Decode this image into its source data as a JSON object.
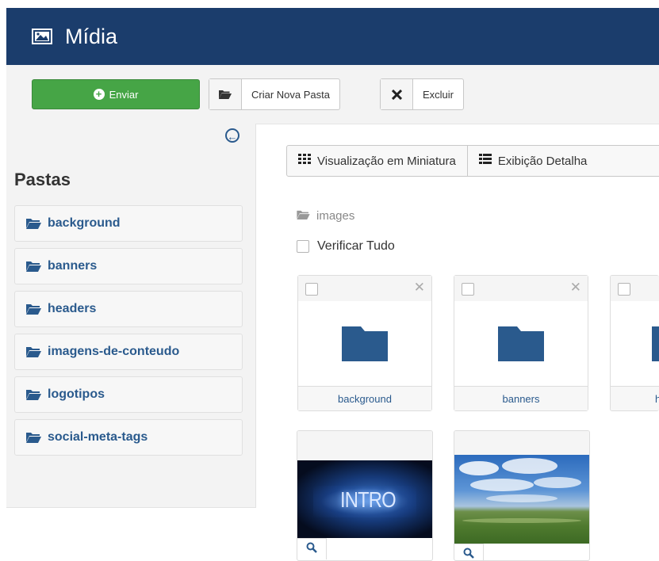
{
  "header": {
    "title": "Mídia",
    "icon": "image-icon",
    "bg_color": "#1b3d6c"
  },
  "toolbar": {
    "upload_label": "Enviar",
    "upload_color": "#46a546",
    "new_folder_label": "Criar Nova Pasta",
    "delete_label": "Excluir"
  },
  "sidebar": {
    "heading": "Pastas",
    "folders": [
      {
        "label": "background"
      },
      {
        "label": "banners"
      },
      {
        "label": "headers"
      },
      {
        "label": "imagens-de-conteudo"
      },
      {
        "label": "logotipos"
      },
      {
        "label": "social-meta-tags"
      }
    ]
  },
  "main": {
    "view_thumbnail_label": "Visualização em Miniatura",
    "view_detail_label": "Exibição Detalha",
    "breadcrumb": "images",
    "check_all_label": "Verificar Tudo",
    "folder_cards": [
      {
        "label": "background"
      },
      {
        "label": "banners"
      },
      {
        "label": "h"
      }
    ],
    "image_cards": [
      {
        "label": "INTRO"
      },
      {
        "label": ""
      }
    ]
  }
}
